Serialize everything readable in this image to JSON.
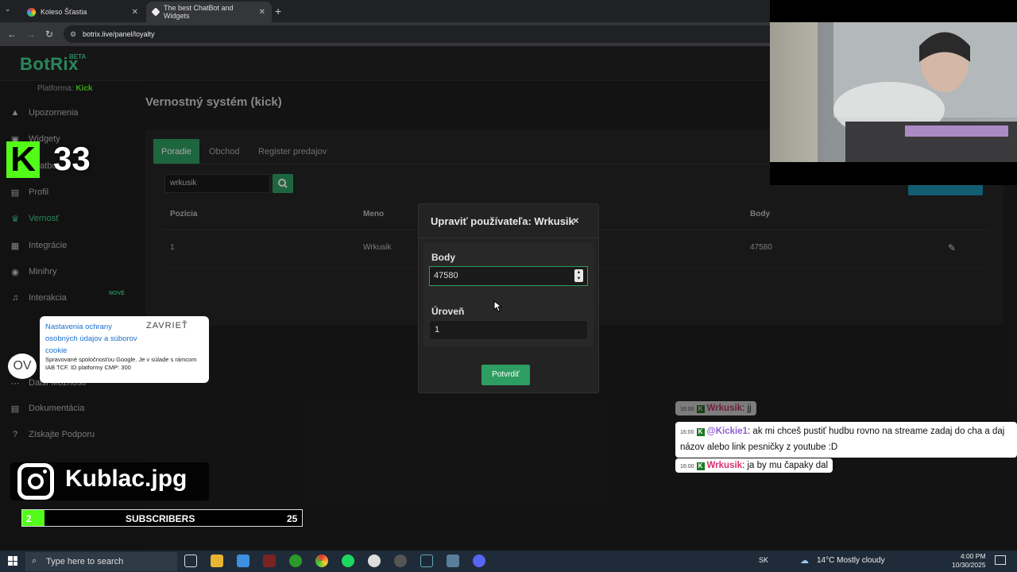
{
  "browser": {
    "tabs": [
      {
        "title": "Koleso Šťastia",
        "active": false
      },
      {
        "title": "The best ChatBot and Widgets",
        "active": true
      }
    ],
    "url": "botrix.live/panel/loyalty"
  },
  "app": {
    "logo": "BotRix",
    "beta": "BETA",
    "platform_label": "Platforma:",
    "platform_value": "Kick",
    "new_badge": "NOVÉ"
  },
  "sidebar": {
    "items": [
      {
        "label": "Upozornenia",
        "icon": "warning-icon"
      },
      {
        "label": "Widgety",
        "icon": "widget-icon"
      },
      {
        "label": "Chatbot",
        "icon": "robot-icon"
      },
      {
        "label": "Profil",
        "icon": "profile-icon"
      },
      {
        "label": "Vernosť",
        "icon": "trophy-icon"
      },
      {
        "label": "Integrácie",
        "icon": "plug-icon"
      },
      {
        "label": "Minihry",
        "icon": "gamepad-icon"
      },
      {
        "label": "Interakcia",
        "icon": "music-icon"
      },
      {
        "label": "Další Možnosti",
        "icon": "more-icon"
      },
      {
        "label": "Dokumentácia",
        "icon": "doc-icon"
      },
      {
        "label": "Získajte Podporu",
        "icon": "help-icon"
      }
    ]
  },
  "loyalty": {
    "title": "Vernostný systém (kick)",
    "tabs": [
      "Poradie",
      "Obchod",
      "Register predajov"
    ],
    "search_value": "wrkusik",
    "table": {
      "headers": [
        "Pozícia",
        "Meno",
        "Body"
      ],
      "rows": [
        {
          "position": "1",
          "name": "Wrkusik",
          "points": "47580"
        }
      ]
    }
  },
  "modal": {
    "title": "Upraviť používateľa: Wrkusik",
    "close": "×",
    "points_label": "Body",
    "points_value": "47580",
    "level_label": "Úroveň",
    "level_value": "1",
    "confirm": "Potvrdiť"
  },
  "cookie": {
    "title": "Nastavenia ochrany osobných údajov a súborov cookie",
    "close": "ZAVRIEŤ",
    "text": "Spravované spoločnosťou Google. Je v súlade s rámcom IAB TCF. ID platformy CMP: 300",
    "badge": "OV"
  },
  "stream_overlay": {
    "k_badge": "K",
    "k_count": "33",
    "instagram": "Kublac.jpg",
    "subs_current": "2",
    "subs_label": "SUBSCRIBERS",
    "subs_goal": "25",
    "subs_progress_fraction": 0.08
  },
  "chat": [
    {
      "time": "16:00",
      "user": "Wrkusik",
      "text": ": jj",
      "user_color": "#d6306f"
    },
    {
      "time": "16:00",
      "user": "@Kickie1",
      "text": ": ak mi chceš pustiť hudbu rovno na streame zadaj do cha a daj názov alebo link pesničky z youtube :D",
      "user_color": "#8e5ed6"
    },
    {
      "time": "16:00",
      "user": "Wrkusik",
      "text": ": ja by mu čapaky dal",
      "user_color": "#d6306f"
    }
  ],
  "taskbar": {
    "search_placeholder": "Type here to search",
    "lang": "SK",
    "weather": "14°C  Mostly cloudy",
    "time": "4:00 PM",
    "date": "10/30/2025"
  },
  "colors": {
    "accent": "#2e9d61",
    "kick_green": "#53fc18",
    "logo_green": "#3ecf8e"
  }
}
